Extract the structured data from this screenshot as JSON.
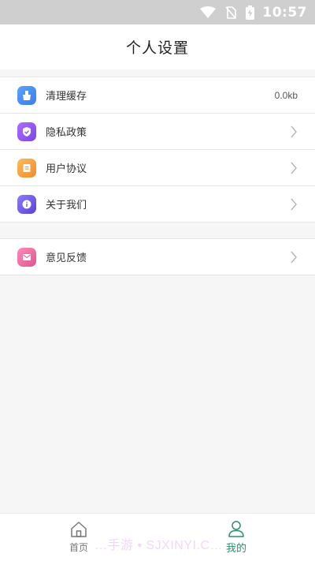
{
  "status_bar": {
    "time": "10:57"
  },
  "header": {
    "title": "个人设置"
  },
  "settings_group_1": [
    {
      "label": "清理缓存",
      "value": "0.0kb",
      "icon": "broom-icon",
      "color": "#4a8cf0"
    },
    {
      "label": "隐私政策",
      "icon": "shield-check-icon",
      "color": "#8a5cf0"
    },
    {
      "label": "用户协议",
      "icon": "document-icon",
      "color": "#f0a040"
    },
    {
      "label": "关于我们",
      "icon": "info-icon",
      "color": "#6c5ce7"
    }
  ],
  "settings_group_2": [
    {
      "label": "意见反馈",
      "icon": "mail-icon",
      "color": "#ec6aa0"
    }
  ],
  "tabbar": {
    "home_label": "首页",
    "mine_label": "我的",
    "active_color": "#2f8f6b"
  },
  "watermark": "…手游 • SJXINYI.C…"
}
